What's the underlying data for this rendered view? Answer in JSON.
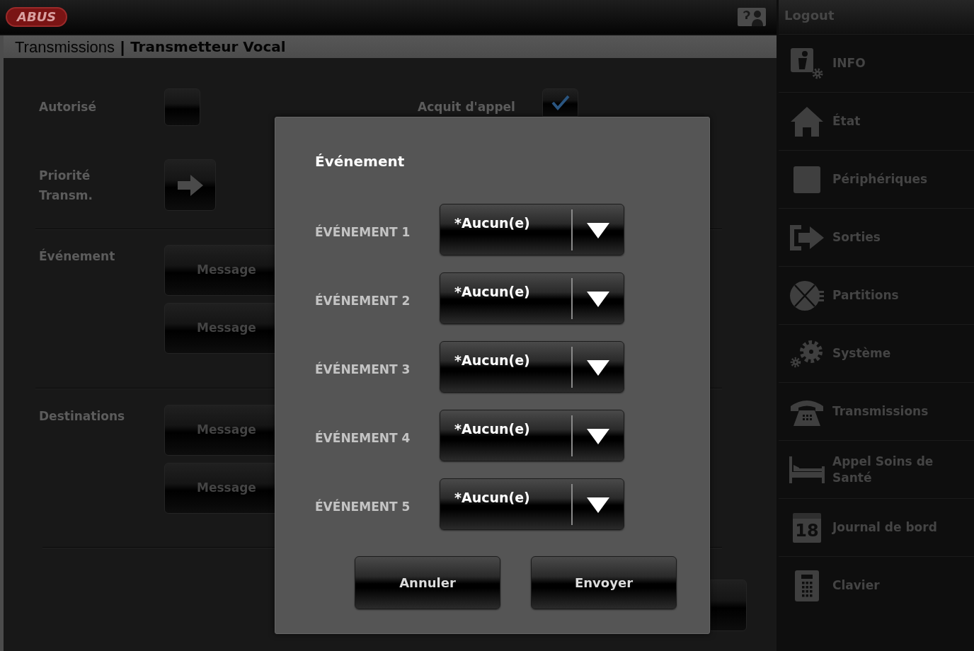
{
  "header": {
    "logo": "ABUS",
    "logout": "Logout"
  },
  "breadcrumb": {
    "parent": "Transmissions",
    "separator": "|",
    "current": "Transmetteur Vocal"
  },
  "form": {
    "checkboxes": [
      {
        "label": "Autorisé",
        "checked": false
      },
      {
        "label": "Acquit d'appel",
        "checked": true
      }
    ],
    "priority": {
      "label": "Priorité Transm."
    },
    "groups": [
      {
        "label": "Événement",
        "buttons": [
          "Message",
          "Message"
        ]
      },
      {
        "label": "Destinations",
        "buttons": [
          "Message",
          "Message"
        ]
      }
    ]
  },
  "sidebar": {
    "items": [
      {
        "label": "INFO"
      },
      {
        "label": "État"
      },
      {
        "label": "Périphériques"
      },
      {
        "label": "Sorties"
      },
      {
        "label": "Partitions"
      },
      {
        "label": "Système"
      },
      {
        "label": "Transmissions"
      },
      {
        "label": "Appel Soins de Santé"
      },
      {
        "label": "Journal de bord",
        "icon_text": "18"
      },
      {
        "label": "Clavier"
      }
    ]
  },
  "dialog": {
    "title": "Événement",
    "rows": [
      {
        "label": "ÉVÉNEMENT 1",
        "value": "*Aucun(e)"
      },
      {
        "label": "ÉVÉNEMENT 2",
        "value": "*Aucun(e)"
      },
      {
        "label": "ÉVÉNEMENT 3",
        "value": "*Aucun(e)"
      },
      {
        "label": "ÉVÉNEMENT 4",
        "value": "*Aucun(e)"
      },
      {
        "label": "ÉVÉNEMENT 5",
        "value": "*Aucun(e)"
      }
    ],
    "buttons": [
      "Annuler",
      "Envoyer"
    ]
  }
}
